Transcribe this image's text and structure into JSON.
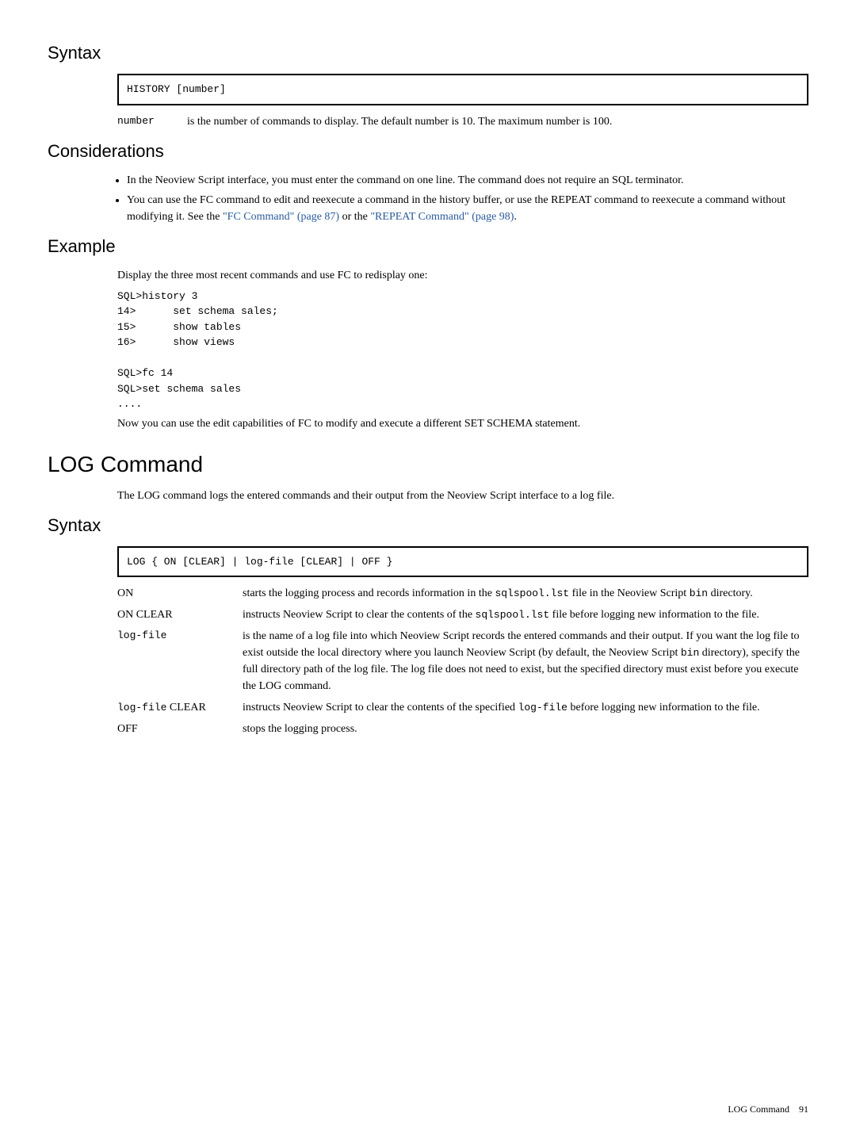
{
  "syntax1": {
    "heading": "Syntax",
    "code": "HISTORY [number]",
    "param": {
      "name": "number",
      "desc": "is the number of commands to display. The default number is 10. The maximum number is 100."
    }
  },
  "considerations": {
    "heading": "Considerations",
    "bullets": [
      "In the Neoview Script interface, you must enter the command on one line. The command does not require an SQL terminator.",
      {
        "pre": "You can use the FC command to edit and reexecute a command in the history buffer, or use the REPEAT command to reexecute a command without modifying it. See the ",
        "link1": "\"FC Command\" (page 87)",
        "mid": " or the ",
        "link2": "\"REPEAT Command\" (page 98)",
        "post": "."
      }
    ]
  },
  "example": {
    "heading": "Example",
    "intro": "Display the three most recent commands and use FC to redisplay one:",
    "code": "SQL>history 3\n14>      set schema sales;\n15>      show tables\n16>      show views\n\nSQL>fc 14\nSQL>set schema sales\n....",
    "outro": "Now you can use the edit capabilities of FC to modify and execute a different SET SCHEMA statement."
  },
  "logcmd": {
    "heading": "LOG Command",
    "intro": "The LOG command logs the entered commands and their output from the Neoview Script interface to a log file."
  },
  "syntax2": {
    "heading": "Syntax",
    "code": "LOG { ON [CLEAR] | log-file [CLEAR] | OFF }",
    "params": {
      "on": {
        "label": "ON",
        "pre": "starts the logging process and records information in the ",
        "mono1": "sqlspool.lst",
        "mid": " file in the Neoview Script ",
        "mono2": "bin",
        "post": " directory."
      },
      "onclear": {
        "label": "ON CLEAR",
        "pre": "instructs Neoview Script to clear the contents of the ",
        "mono1": "sqlspool.lst",
        "post": " file before logging new information to the file."
      },
      "logfile": {
        "label": "log-file",
        "pre": "is the name of a log file into which Neoview Script records the entered commands and their output. If you want the log file to exist outside the local directory where you launch Neoview Script (by default, the Neoview Script ",
        "mono1": "bin",
        "post": " directory), specify the full directory path of the log file. The log file does not need to exist, but the specified directory must exist before you execute the LOG command."
      },
      "logfileclear": {
        "label_mono": "log-file",
        "label_plain": " CLEAR",
        "pre": "instructs Neoview Script to clear the contents of the specified ",
        "mono1": "log-file",
        "post": " before logging new information to the file."
      },
      "off": {
        "label": "OFF",
        "desc": "stops the logging process."
      }
    }
  },
  "footer": {
    "title": "LOG Command",
    "page": "91"
  }
}
